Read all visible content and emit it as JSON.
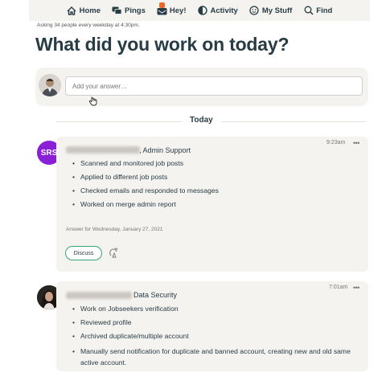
{
  "nav": {
    "items": [
      {
        "label": "Home",
        "icon": "home-icon"
      },
      {
        "label": "Pings",
        "icon": "pings-icon"
      },
      {
        "label": "Hey!",
        "icon": "hey-icon"
      },
      {
        "label": "Activity",
        "icon": "activity-icon"
      },
      {
        "label": "My Stuff",
        "icon": "my-stuff-icon"
      },
      {
        "label": "Find",
        "icon": "search-icon"
      }
    ]
  },
  "header": {
    "subline": "Asking 34 people every weekday at 4:30pm.",
    "title": "What did you work on today?"
  },
  "answer": {
    "placeholder": "Add your answer…"
  },
  "divider": {
    "label": "Today"
  },
  "entries": [
    {
      "avatar_initials": "SRS",
      "avatar_color": "#8a1fd6",
      "role": ", Admin Support",
      "time": "9:23am",
      "more": "•••",
      "tasks": [
        "Scanned and monitored job posts",
        "Applied to different job posts",
        "Checked emails and responded to messages",
        "Worked on merge admin report"
      ],
      "answer_for": "Answer for Wednesday, January 27, 2021",
      "discuss_label": "Discuss"
    },
    {
      "role": "Data Security",
      "time": "7:01am",
      "more": "•••",
      "tasks": [
        "Work on Jobseekers verification",
        "Reviewed profile",
        "Archived duplicate/multiple account",
        "Manually send notification for duplicate and banned account, creating new and old same active account."
      ]
    }
  ],
  "colors": {
    "text": "#283c46",
    "card": "#f5f3ef",
    "accent_green": "#3aa57a",
    "hey_badge": "#e8692a"
  }
}
